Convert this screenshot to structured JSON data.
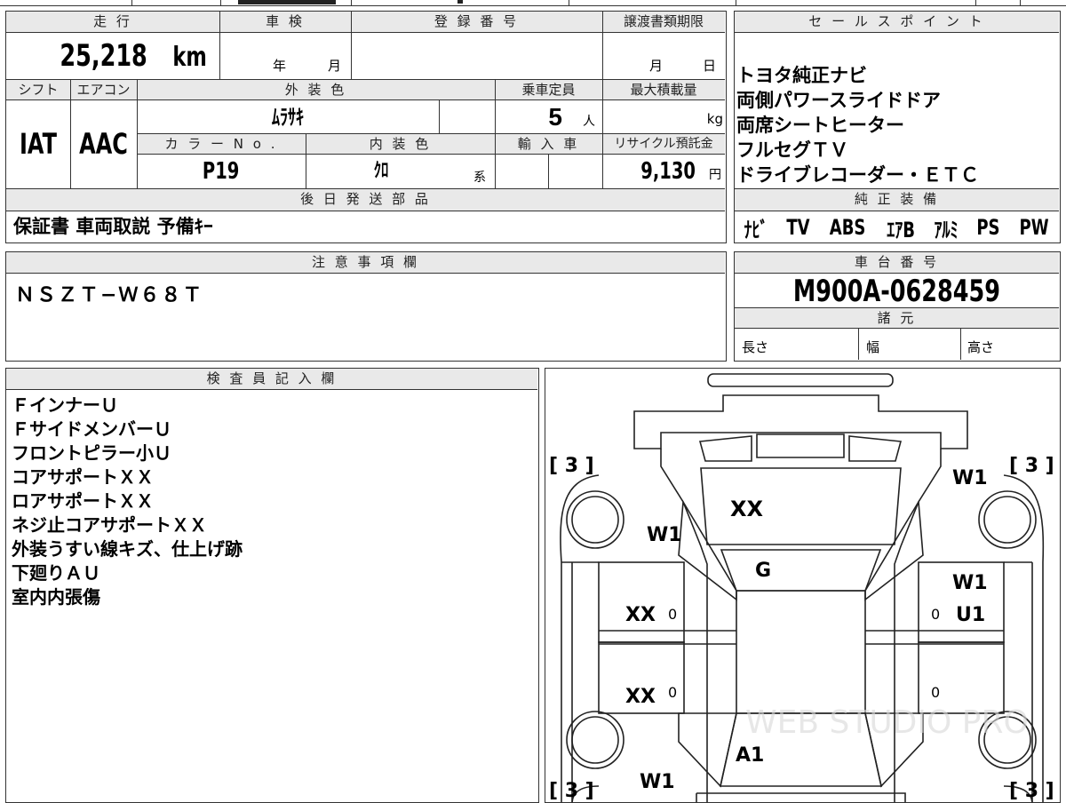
{
  "spec_table": {
    "mileage_header": "走 行",
    "mileage_value": "25,218",
    "mileage_unit": "km",
    "inspection_header": "車 検",
    "inspection_year_label": "年",
    "inspection_month_label": "月",
    "registration_header": "登 録 番 号",
    "transfer_deadline_header": "譲渡書類期限",
    "transfer_month_label": "月",
    "transfer_day_label": "日",
    "shift_header": "シフト",
    "shift_value": "IAT",
    "aircon_header": "エアコン",
    "aircon_value": "AAC",
    "exterior_color_header": "外 装 色",
    "exterior_color_value": "ﾑﾗｻｷ",
    "capacity_header": "乗車定員",
    "capacity_value": "5",
    "capacity_unit": "人",
    "max_load_header": "最大積載量",
    "max_load_unit": "kg",
    "color_no_header": "カ ラ ー N o .",
    "color_no_value": "P19",
    "interior_color_header": "内 装 色",
    "interior_color_value": "ｸﾛ",
    "interior_color_suffix": "系",
    "import_header": "輸 入 車",
    "recycle_header": "リサイクル預託金",
    "recycle_value": "9,130",
    "recycle_unit": "円",
    "later_parts_header": "後 日 発 送 部 品",
    "later_parts_value": "保証書 車両取説 予備ｷｰ"
  },
  "sales_points": {
    "header": "セ ー ル ス ポ イ ン ト",
    "items": [
      "トヨタ純正ナビ",
      "両側パワースライドドア",
      "両席シートヒーター",
      "フルセグＴＶ",
      "ドライブレコーダー・ＥＴＣ"
    ]
  },
  "genuine_equipment": {
    "header": "純 正 装 備",
    "items": [
      "ﾅﾋﾞ",
      "TV",
      "ABS",
      "ｴｱB",
      "ｱﾙﾐ",
      "PS",
      "PW"
    ]
  },
  "notes": {
    "header": "注 意 事 項 欄",
    "value": "ＮＳＺＴ−Ｗ６８Ｔ"
  },
  "chassis": {
    "header": "車 台 番 号",
    "value": "M900A-0628459",
    "specs_header": "諸 元",
    "length_label": "長さ",
    "width_label": "幅",
    "height_label": "高さ"
  },
  "inspector": {
    "header": "検 査 員 記 入 欄",
    "items": [
      "ＦインナーＵ",
      "ＦサイドメンバーＵ",
      "フロントピラー小Ｕ",
      "コアサポートＸＸ",
      "ロアサポートＸＸ",
      "ネジ止コアサポートＸＸ",
      "外装うすい線キズ、仕上げ跡",
      "下廻りＡＵ",
      "室内内張傷"
    ]
  },
  "diagram": {
    "tire_front_left": "[ 3 ]",
    "tire_front_right": "[ 3 ]",
    "tire_rear_left": "[ 3 ]",
    "tire_rear_right": "[ 3 ]",
    "windshield": "XX",
    "hood": "G",
    "roof": "A1",
    "front_left_fender": "W1",
    "front_right_fender": "W1",
    "front_right_door": "W1",
    "front_right_door_code": "U1",
    "front_left_door": "XX",
    "rear_left_door": "XX",
    "rear_left_quarter": "W1",
    "front_left_door_mark": "0",
    "rear_left_door_mark": "0",
    "front_right_door_mark": "0",
    "rear_right_door_mark": "0",
    "watermark": "WEB STUDIO PRO"
  }
}
